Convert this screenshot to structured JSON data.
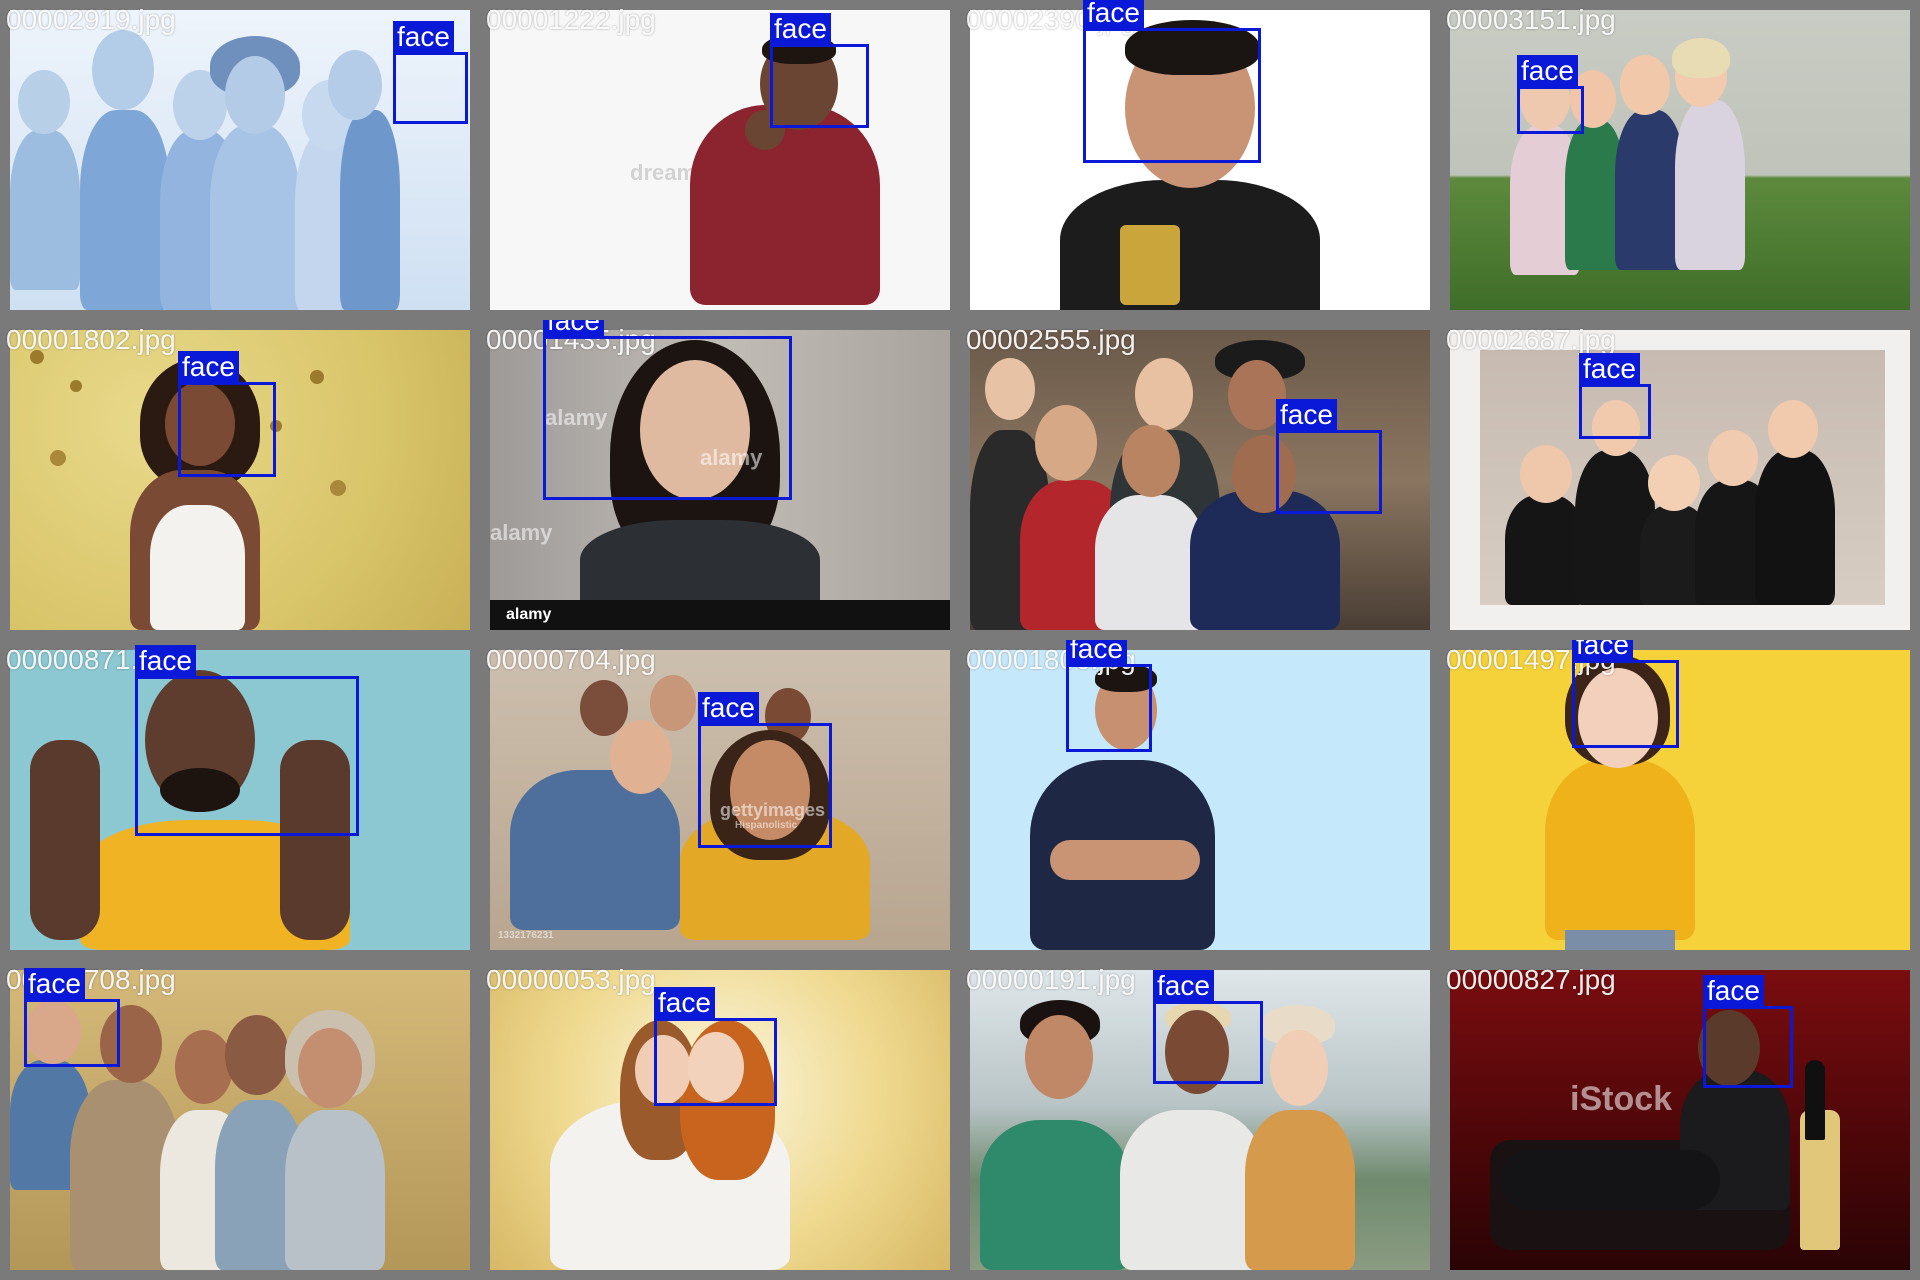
{
  "colors": {
    "border": "#7a7a7a",
    "box": "#0a18d8",
    "label_text": "#ffffff"
  },
  "tiles": [
    {
      "filename": "00002919.jpg",
      "label": "face"
    },
    {
      "filename": "00001222.jpg",
      "label": "face"
    },
    {
      "filename": "00002390.jpg",
      "label": "face"
    },
    {
      "filename": "00003151.jpg",
      "label": "face"
    },
    {
      "filename": "00001802.jpg",
      "label": "face"
    },
    {
      "filename": "00001435.jpg",
      "label": "face"
    },
    {
      "filename": "00002555.jpg",
      "label": "face"
    },
    {
      "filename": "00002687.jpg",
      "label": "face"
    },
    {
      "filename": "00000871.jpg",
      "label": "face"
    },
    {
      "filename": "00000704.jpg",
      "label": "face"
    },
    {
      "filename": "00001806.jpg",
      "label": "face"
    },
    {
      "filename": "00001497.jpg",
      "label": "face"
    },
    {
      "filename": "00002708.jpg",
      "label": "face"
    },
    {
      "filename": "00000053.jpg",
      "label": "face"
    },
    {
      "filename": "00000191.jpg",
      "label": "face"
    },
    {
      "filename": "00000827.jpg",
      "label": "face"
    }
  ],
  "watermarks": {
    "t1": "dreamstime",
    "t5a": "alamy",
    "t5b": "alamy",
    "t5c": "alamy",
    "t5bar": "alamy",
    "t9": "gettyimages",
    "t9b": "Hispanolistic",
    "t9c": "1332176231",
    "t15": "iStock"
  }
}
